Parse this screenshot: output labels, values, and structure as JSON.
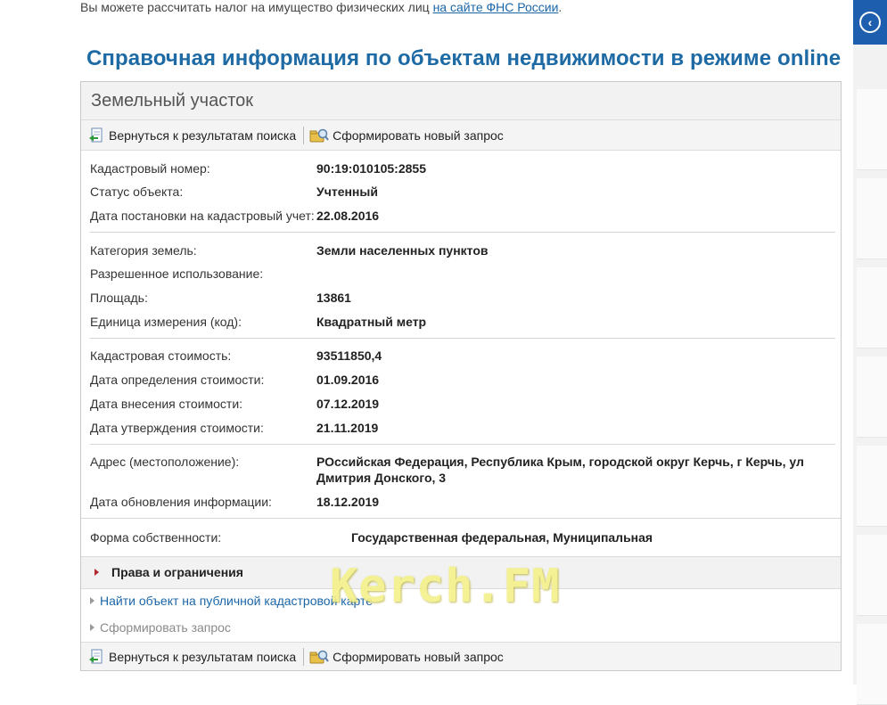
{
  "top_note": {
    "text": "Вы можете рассчитать налог на имущество физических лиц ",
    "link": "на сайте ФНС России",
    "suffix": "."
  },
  "heading": "Справочная информация по объектам недвижимости в режиме online",
  "card": {
    "title": "Земельный участок",
    "toolbar": {
      "back_label": "Вернуться к результатам поиска",
      "new_query_label": "Сформировать новый запрос"
    },
    "fields": [
      {
        "label": "Кадастровый номер:",
        "value": "90:19:010105:2855"
      },
      {
        "label": "Статус объекта:",
        "value": "Учтенный"
      },
      {
        "label": "Дата постановки на кадастровый учет:",
        "value": "22.08.2016"
      },
      {
        "label": "Категория земель:",
        "value": "Земли населенных пунктов"
      },
      {
        "label": "Разрешенное использование:",
        "value": ""
      },
      {
        "label": "Площадь:",
        "value": "13861"
      },
      {
        "label": "Единица измерения (код):",
        "value": "Квадратный метр"
      },
      {
        "label": "Кадастровая стоимость:",
        "value": "93511850,4"
      },
      {
        "label": "Дата определения стоимости:",
        "value": "01.09.2016"
      },
      {
        "label": "Дата внесения стоимости:",
        "value": "07.12.2019"
      },
      {
        "label": "Дата утверждения стоимости:",
        "value": "21.11.2019"
      },
      {
        "label": "Адрес (местоположение):",
        "value": "РОссийская Федерация, Республика Крым, городской округ Керчь, г Керчь, ул Дмитрия Донского, 3"
      },
      {
        "label": "Дата обновления информации:",
        "value": "18.12.2019"
      },
      {
        "label": "Форма собственности:",
        "value": "Государственная федеральная, Муниципальная"
      }
    ],
    "rights_label": "Права и ограничения",
    "links": {
      "map": "Найти объект на публичной кадастровой карте",
      "request": "Сформировать запрос"
    },
    "bottom_toolbar": {
      "back_label": "Вернуться к результатам поиска",
      "new_query_label": "Сформировать новый запрос"
    }
  },
  "watermark": "Kerch.FM",
  "side": {
    "icon": "chevron-left-icon",
    "color": "#1d5fae"
  }
}
